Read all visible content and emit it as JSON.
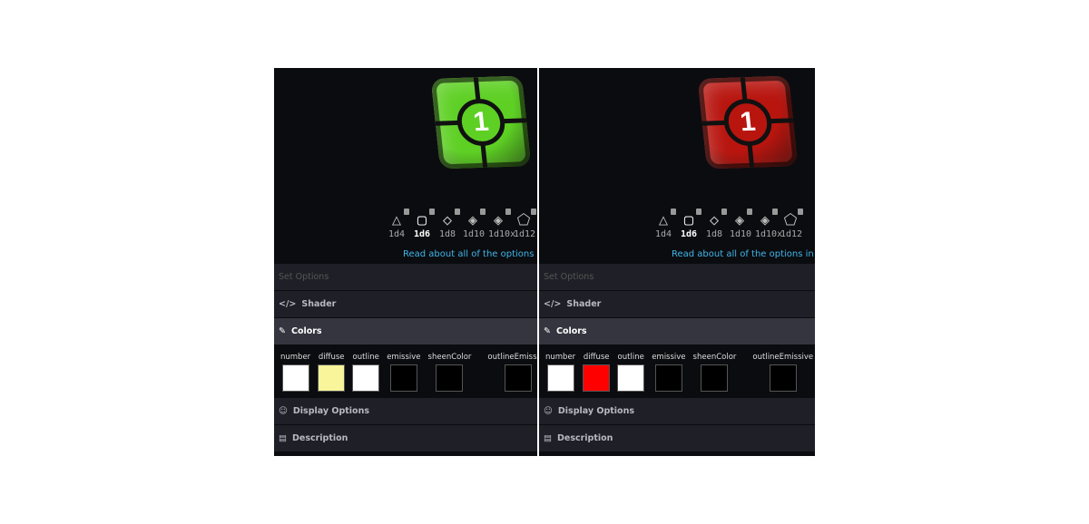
{
  "panels": [
    {
      "die_color": "#5ed024",
      "die_number": "1",
      "active_die": "1d6",
      "dice": [
        {
          "label": "1d4",
          "icon": "tetrahedron-icon",
          "glyph": "△"
        },
        {
          "label": "1d6",
          "icon": "cube-icon",
          "glyph": "▢"
        },
        {
          "label": "1d8",
          "icon": "octahedron-icon",
          "glyph": "◇"
        },
        {
          "label": "1d10",
          "icon": "d10-icon",
          "glyph": "◈"
        },
        {
          "label": "1d10x",
          "icon": "d10x-icon",
          "glyph": "◈"
        },
        {
          "label": "1d12",
          "icon": "dodecahedron-icon",
          "glyph": "⬠"
        }
      ],
      "link": "Read about all of the options in o",
      "rows": {
        "set_options": "Set Options",
        "shader": "Shader",
        "colors": "Colors",
        "display": "Display Options",
        "description": "Description"
      },
      "swatches": [
        {
          "label": "number",
          "color": "#ffffff"
        },
        {
          "label": "diffuse",
          "color": "#f8f59a"
        },
        {
          "label": "outline",
          "color": "#ffffff"
        },
        {
          "label": "emissive",
          "color": "#000000"
        },
        {
          "label": "sheenColor",
          "color": "#000000"
        },
        {
          "label": "outlineEmissive",
          "color": "#000000"
        }
      ]
    },
    {
      "die_color": "#b8150f",
      "die_number": "1",
      "active_die": "1d6",
      "dice": [
        {
          "label": "1d4",
          "icon": "tetrahedron-icon",
          "glyph": "△"
        },
        {
          "label": "1d6",
          "icon": "cube-icon",
          "glyph": "▢"
        },
        {
          "label": "1d8",
          "icon": "octahedron-icon",
          "glyph": "◇"
        },
        {
          "label": "1d10",
          "icon": "d10-icon",
          "glyph": "◈"
        },
        {
          "label": "1d10x",
          "icon": "d10x-icon",
          "glyph": "◈"
        },
        {
          "label": "1d12",
          "icon": "dodecahedron-icon",
          "glyph": "⬠"
        }
      ],
      "link": "Read about all of the options in ou",
      "rows": {
        "set_options": "Set Options",
        "shader": "Shader",
        "colors": "Colors",
        "display": "Display Options",
        "description": "Description"
      },
      "swatches": [
        {
          "label": "number",
          "color": "#ffffff"
        },
        {
          "label": "diffuse",
          "color": "#ff0000"
        },
        {
          "label": "outline",
          "color": "#ffffff"
        },
        {
          "label": "emissive",
          "color": "#000000"
        },
        {
          "label": "sheenColor",
          "color": "#000000"
        },
        {
          "label": "outlineEmissive",
          "color": "#000000"
        }
      ]
    }
  ]
}
